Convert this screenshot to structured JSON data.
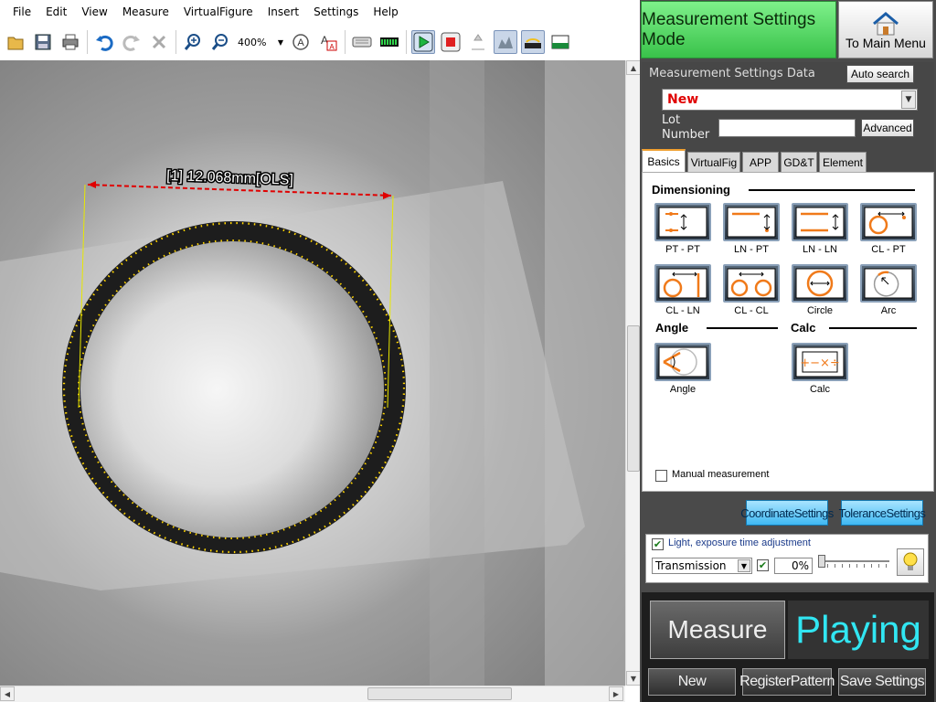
{
  "menu": [
    "File",
    "Edit",
    "View",
    "Measure",
    "VirtualFigure",
    "Insert",
    "Settings",
    "Help"
  ],
  "toolbar": {
    "zoom": "400%",
    "icons": [
      "open-icon",
      "save-icon",
      "print-icon",
      "undo-icon",
      "redo-icon",
      "delete-icon",
      "zoom-in-icon",
      "zoom-out-icon",
      "ocr-text-icon",
      "font-icon",
      "keyboard-icon",
      "level-meter-icon",
      "play-icon",
      "stop-icon",
      "auto-focus-icon",
      "edge-detect-icon",
      "light-icon",
      "display-icon"
    ]
  },
  "measurement_label": "[1] 12.068mm[OLS]",
  "mode_button": "Measurement Settings Mode",
  "main_menu_button": "To Main Menu",
  "settings_data": {
    "title": "Measurement Settings Data",
    "auto_search": "Auto search",
    "selected": "New",
    "lot_label_1": "Lot",
    "lot_label_2": "Number",
    "lot_value": "",
    "advanced": "Advanced"
  },
  "tabs": [
    "Basics",
    "VirtualFig",
    "APP",
    "GD&T",
    "Element"
  ],
  "sections": {
    "dimensioning": "Dimensioning",
    "angle": "Angle",
    "calc": "Calc"
  },
  "measure_buttons": [
    "PT - PT",
    "LN - PT",
    "LN - LN",
    "CL - PT",
    "CL - LN",
    "CL - CL",
    "Circle",
    "Arc"
  ],
  "angle_button": "Angle",
  "calc_button": "Calc",
  "manual_measurement": "Manual measurement",
  "coordinate_settings": "CoordinateSettings",
  "tolerance_settings": "ToleranceSettings",
  "light": {
    "label": "Light, exposure time adjustment",
    "mode": "Transmission",
    "value": "0%"
  },
  "measure_button": "Measure",
  "status": "Playing",
  "bottom_buttons": {
    "new": "New",
    "register": "RegisterPattern",
    "save": "Save Settings"
  },
  "colors": {
    "mode_green": "#39c24a",
    "status_cyan": "#31e6f2",
    "accent_orange": "#f07a1a",
    "measure_red": "#e00000"
  }
}
